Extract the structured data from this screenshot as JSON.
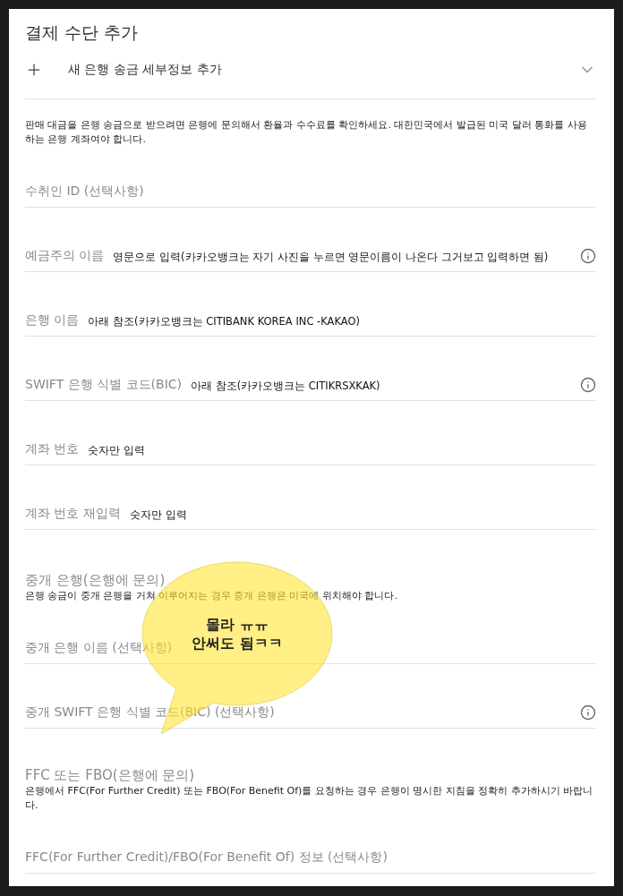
{
  "title": "결제 수단 추가",
  "add_row": {
    "label": "새 은행 송금 세부정보 추가",
    "expanded": false
  },
  "notice": "판매 대금을 은행 송금으로 받으려면 은행에 문의해서 환율과 수수료를 확인하세요. 대한민국에서 발급된 미국 달러 통화를 사용하는 은행 계좌여야 합니다.",
  "form": [
    {
      "kind": "field",
      "label": "수취인 ID (선택사항)",
      "info": false
    },
    {
      "kind": "field",
      "label": "예금주의 이름",
      "note": "영문으로 입력(카카오뱅크는 자기 사진을 누르면 영문이름이 나온다 그거보고 입력하면 됨)",
      "info": true
    },
    {
      "kind": "field",
      "label": "은행 이름",
      "note": "아래 참조(카카오뱅크는 CITIBANK KOREA INC -KAKAO)",
      "info": false
    },
    {
      "kind": "field",
      "label": "SWIFT 은행 식별 코드(BIC)",
      "note": "아래 참조(카카오뱅크는 CITIKRSXKAK)",
      "info": true
    },
    {
      "kind": "field",
      "label": "계좌 번호",
      "note": "숫자만 입력",
      "info": false
    },
    {
      "kind": "field",
      "label": "계좌 번호 재입력",
      "note": "숫자만 입력",
      "info": false
    },
    {
      "kind": "section",
      "title": "중개 은행(은행에 문의)",
      "help": "은행 송금이 중개 은행을 거쳐 이루어지는 경우 중개 은행은 미국에 위치해야 합니다."
    },
    {
      "kind": "field",
      "label": "중개 은행 이름 (선택사항)",
      "info": false
    },
    {
      "kind": "field",
      "label": "중개 SWIFT 은행 식별 코드(BIC) (선택사항)",
      "info": true
    },
    {
      "kind": "section",
      "title": "FFC 또는 FBO(은행에 문의)",
      "help": "은행에서 FFC(For Further Credit) 또는 FBO(For Benefit Of)를 요청하는 경우 은행이 명시한 지침을 정확히 추가하시기 바랍니다."
    },
    {
      "kind": "field",
      "label": "FFC(For Further Credit)/FBO(For Benefit Of) 정보 (선택사항)",
      "info": false
    }
  ],
  "callout": {
    "lines": [
      "몰라 ㅠㅠ",
      "안써도 됨ㅋㅋ"
    ]
  }
}
